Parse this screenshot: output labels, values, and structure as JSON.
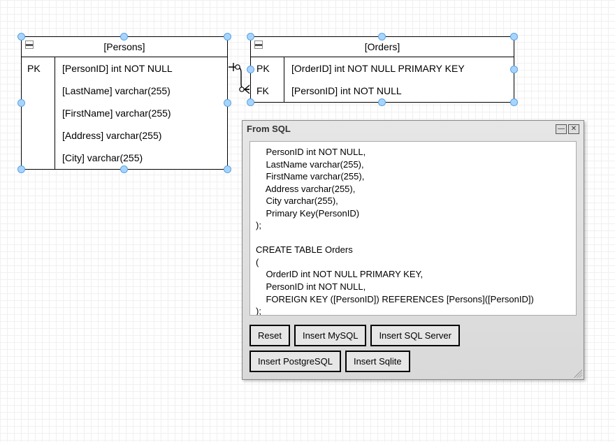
{
  "entities": {
    "persons": {
      "title": "[Persons]",
      "keys": [
        "PK",
        "",
        "",
        "",
        ""
      ],
      "cols": [
        "[PersonID] int NOT NULL",
        "[LastName] varchar(255)",
        "[FirstName] varchar(255)",
        "[Address] varchar(255)",
        "[City] varchar(255)"
      ]
    },
    "orders": {
      "title": "[Orders]",
      "keys": [
        "PK",
        "FK"
      ],
      "cols": [
        "[OrderID] int NOT NULL PRIMARY KEY",
        "[PersonID] int NOT NULL"
      ]
    }
  },
  "dialog": {
    "title": "From SQL",
    "sql": "    PersonID int NOT NULL,\n    LastName varchar(255),\n    FirstName varchar(255),\n    Address varchar(255),\n    City varchar(255),\n    Primary Key(PersonID)\n);\n\nCREATE TABLE Orders\n(\n    OrderID int NOT NULL PRIMARY KEY,\n    PersonID int NOT NULL,\n    FOREIGN KEY ([PersonID]) REFERENCES [Persons]([PersonID])\n);",
    "buttons": {
      "reset": "Reset",
      "mysql": "Insert MySQL",
      "sqlserver": "Insert SQL Server",
      "postgres": "Insert PostgreSQL",
      "sqlite": "Insert Sqlite"
    },
    "minimize_glyph": "—",
    "close_glyph": "✕"
  },
  "collapse_glyph": "▬"
}
